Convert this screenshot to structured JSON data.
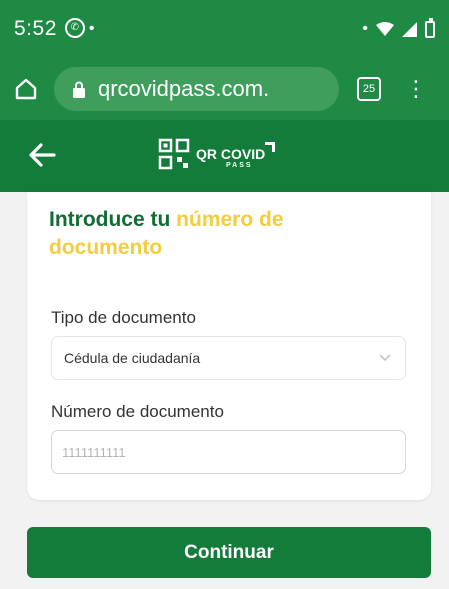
{
  "status_bar": {
    "time": "5:52",
    "left_dot": "•",
    "right_dot": "•"
  },
  "browser": {
    "url": "qrcovidpass.com.",
    "tab_count": "25"
  },
  "header": {
    "logo_main": "QR COVID",
    "logo_sub": "PASS"
  },
  "form": {
    "title_part1": "Introduce tu ",
    "title_part2": "número de documento",
    "doc_type_label": "Tipo de documento",
    "doc_type_value": "Cédula de ciudadanía",
    "doc_number_label": "Número de documento",
    "doc_number_placeholder": "1111111111"
  },
  "actions": {
    "continue_label": "Continuar"
  },
  "colors": {
    "primary_green": "#137c3b",
    "title_green": "#146b35",
    "highlight_yellow": "#f4cd3d"
  }
}
